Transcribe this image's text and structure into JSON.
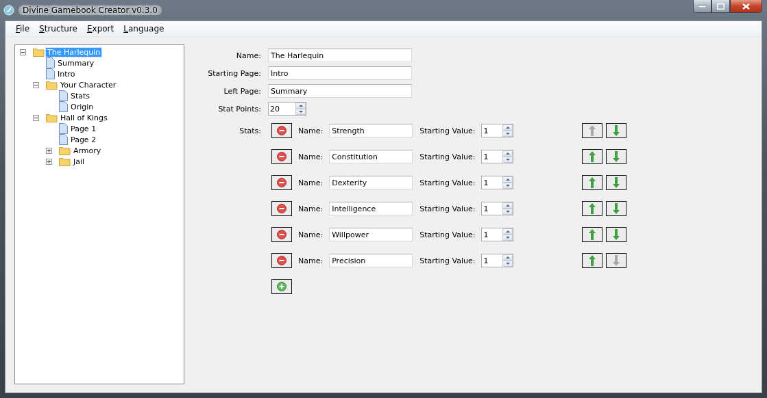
{
  "window": {
    "title": "Divine Gamebook Creator v0.3.0"
  },
  "menu": [
    "File",
    "Structure",
    "Export",
    "Language"
  ],
  "tree": [
    {
      "label": "The Harlequin",
      "kind": "folder",
      "expanded": true,
      "selected": true,
      "children": [
        {
          "label": "Summary",
          "kind": "page",
          "selected": false
        },
        {
          "label": "Intro",
          "kind": "page",
          "selected": false
        },
        {
          "label": "Your Character",
          "kind": "folder",
          "expanded": true,
          "selected": false,
          "children": [
            {
              "label": "Stats",
              "kind": "page",
              "selected": false
            },
            {
              "label": "Origin",
              "kind": "page",
              "selected": false
            }
          ]
        },
        {
          "label": "Hall of Kings",
          "kind": "folder",
          "expanded": true,
          "selected": false,
          "children": [
            {
              "label": "Page 1",
              "kind": "page",
              "selected": false
            },
            {
              "label": "Page 2",
              "kind": "page",
              "selected": false
            },
            {
              "label": "Armory",
              "kind": "folder",
              "expanded": false,
              "selected": false
            },
            {
              "label": "Jail",
              "kind": "folder",
              "expanded": false,
              "selected": false
            }
          ]
        }
      ]
    }
  ],
  "form": [
    {
      "label": "Name:",
      "value": "The Harlequin",
      "kind": "text"
    },
    {
      "label": "Starting Page:",
      "value": "Intro",
      "kind": "text"
    },
    {
      "label": "Left Page:",
      "value": "Summary",
      "kind": "text"
    },
    {
      "label": "Stat Points:",
      "value": "20",
      "kind": "spin"
    }
  ],
  "stats_label": "Stats:",
  "stats": [
    {
      "name_label": "Name:",
      "name": "Strength",
      "value_label": "Starting Value:",
      "value": "1",
      "up_disabled": true,
      "down_disabled": false
    },
    {
      "name_label": "Name:",
      "name": "Constitution",
      "value_label": "Starting Value:",
      "value": "1",
      "up_disabled": false,
      "down_disabled": false
    },
    {
      "name_label": "Name:",
      "name": "Dexterity",
      "value_label": "Starting Value:",
      "value": "1",
      "up_disabled": false,
      "down_disabled": false
    },
    {
      "name_label": "Name:",
      "name": "Intelligence",
      "value_label": "Starting Value:",
      "value": "1",
      "up_disabled": false,
      "down_disabled": false
    },
    {
      "name_label": "Name:",
      "name": "Willpower",
      "value_label": "Starting Value:",
      "value": "1",
      "up_disabled": false,
      "down_disabled": false
    },
    {
      "name_label": "Name:",
      "name": "Precision",
      "value_label": "Starting Value:",
      "value": "1",
      "up_disabled": false,
      "down_disabled": true
    }
  ]
}
